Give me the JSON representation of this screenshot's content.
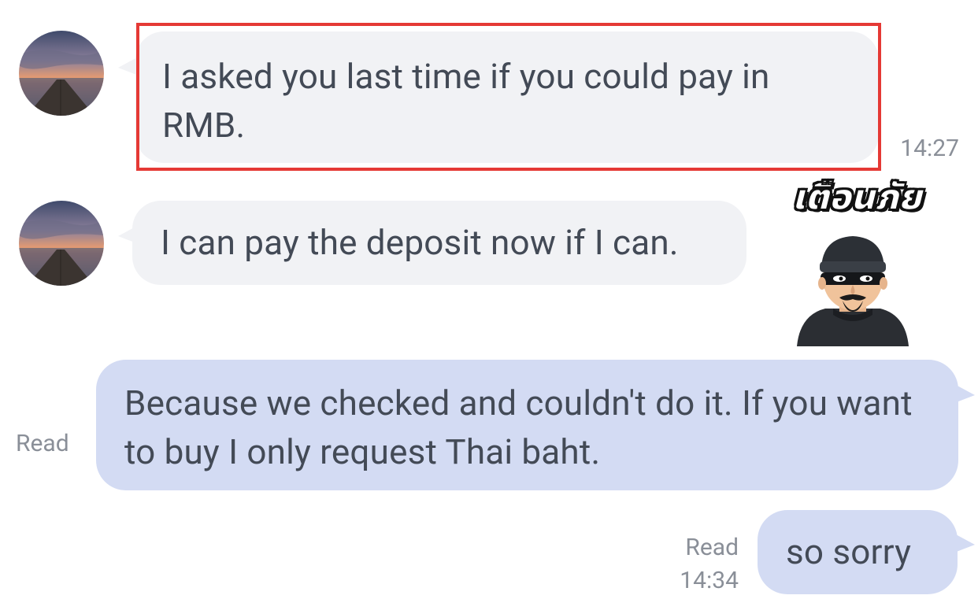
{
  "chat": {
    "messages": [
      {
        "id": "m1",
        "direction": "incoming",
        "text": "I asked you last time if you could pay in RMB.",
        "time": "14:27",
        "highlighted": true
      },
      {
        "id": "m2",
        "direction": "incoming",
        "text": "I can pay the deposit now if I can.",
        "time": ""
      },
      {
        "id": "m3",
        "direction": "outgoing",
        "text": "Because we checked and couldn't do it. If you want to buy I only request Thai baht.",
        "status": "Read",
        "time": ""
      },
      {
        "id": "m4",
        "direction": "outgoing",
        "text": "so sorry",
        "status": "Read",
        "time": "14:34"
      }
    ],
    "sticker": {
      "label": "เตือนภัย",
      "icon": "masked-thief-icon"
    },
    "colors": {
      "incoming_bubble": "#f1f2f5",
      "outgoing_bubble": "#d3dbf3",
      "text": "#434a56",
      "meta_text": "#8a8f98",
      "highlight_border": "#e53935"
    }
  }
}
